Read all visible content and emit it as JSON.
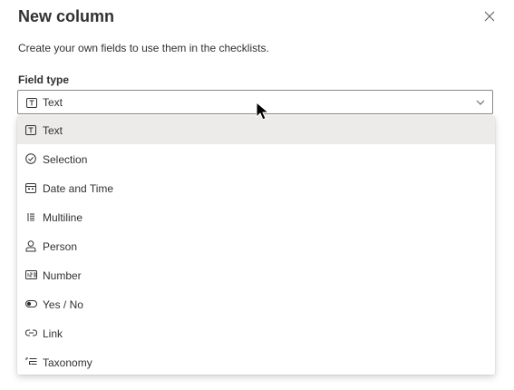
{
  "dialog": {
    "title": "New column",
    "subtitle": "Create your own fields to use them in the checklists.",
    "close_icon": "close-icon"
  },
  "field_type": {
    "label": "Field type",
    "selected_value": "Text",
    "selected_icon": "text-icon",
    "chevron_icon": "chevron-down-icon"
  },
  "options": [
    {
      "label": "Text",
      "icon": "text-icon",
      "selected": true
    },
    {
      "label": "Selection",
      "icon": "check-circle-icon",
      "selected": false
    },
    {
      "label": "Date and Time",
      "icon": "calendar-icon",
      "selected": false
    },
    {
      "label": "Multiline",
      "icon": "multiline-icon",
      "selected": false
    },
    {
      "label": "Person",
      "icon": "person-icon",
      "selected": false
    },
    {
      "label": "Number",
      "icon": "number-icon",
      "selected": false
    },
    {
      "label": "Yes / No",
      "icon": "toggle-icon",
      "selected": false
    },
    {
      "label": "Link",
      "icon": "link-icon",
      "selected": false
    },
    {
      "label": "Taxonomy",
      "icon": "taxonomy-icon",
      "selected": false
    }
  ],
  "colors": {
    "text": "#323130",
    "selected_bg": "#edebe9",
    "border": "#8a8886"
  }
}
